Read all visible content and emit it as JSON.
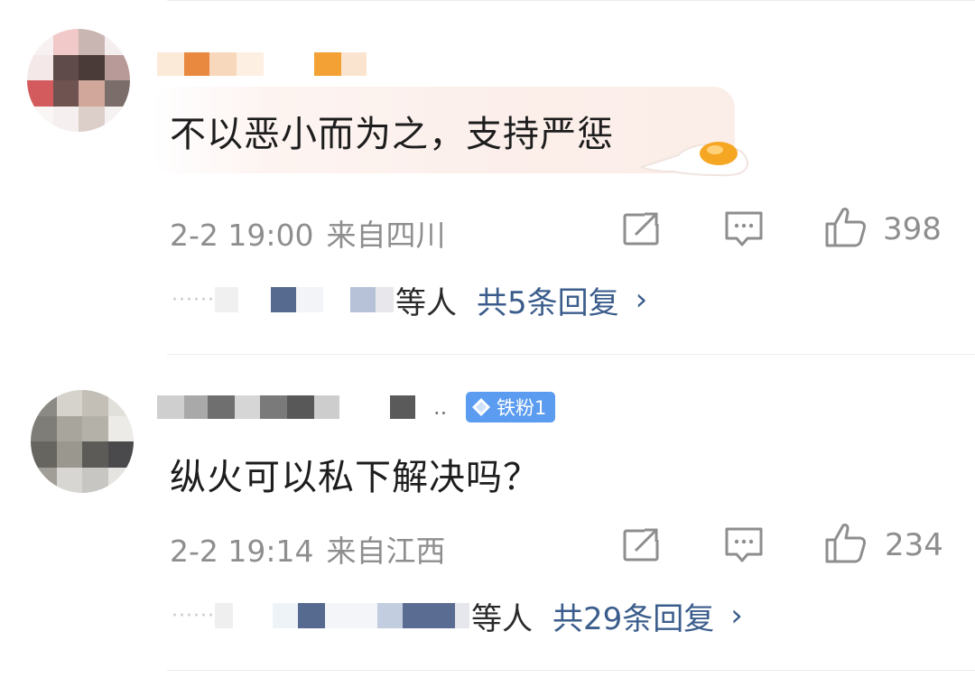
{
  "comments": [
    {
      "text": "不以恶小而为之，支持严惩",
      "date": "2-2 19:00",
      "location": "来自四川",
      "likes": "398",
      "replies_suffix": "等人",
      "replies_total": "共5条回复",
      "chevron": "›"
    },
    {
      "badge": "铁粉1",
      "text": "纵火可以私下解决吗？",
      "date": "2-2 19:14",
      "location": "来自江西",
      "likes": "234",
      "replies_suffix": "等人",
      "replies_total": "共29条回复",
      "chevron": "›"
    }
  ],
  "icons": {
    "share": "share-icon",
    "comment": "comment-icon",
    "like": "thumbs-up-icon",
    "badge": "diamond-icon"
  },
  "colors": {
    "link": "#3b5d8c",
    "meta": "#8e8e8e",
    "badge": "#5b9cf0"
  }
}
